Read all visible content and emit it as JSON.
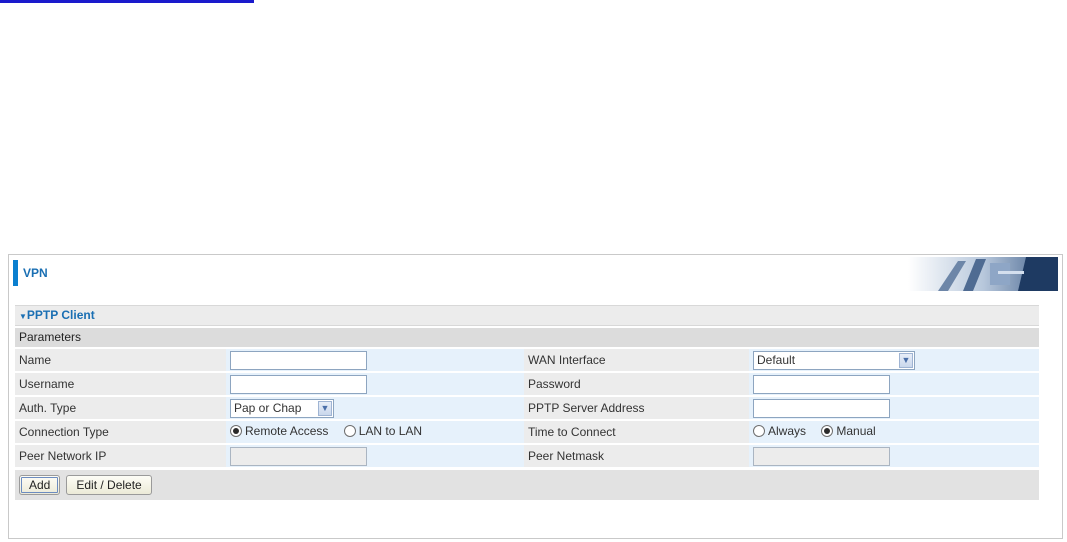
{
  "header": {
    "title": "VPN"
  },
  "section": {
    "title": "PPTP Client",
    "subheader": "Parameters"
  },
  "fields": {
    "name": {
      "label": "Name",
      "value": ""
    },
    "username": {
      "label": "Username",
      "value": ""
    },
    "auth_type": {
      "label": "Auth. Type",
      "selected": "Pap or Chap"
    },
    "connection_type": {
      "label": "Connection Type",
      "options": [
        "Remote Access",
        "LAN to LAN"
      ],
      "selected": "Remote Access"
    },
    "peer_network_ip": {
      "label": "Peer Network IP",
      "value": ""
    },
    "wan_interface": {
      "label": "WAN Interface",
      "selected": "Default"
    },
    "password": {
      "label": "Password",
      "value": ""
    },
    "pptp_server_address": {
      "label": "PPTP Server Address",
      "value": ""
    },
    "time_to_connect": {
      "label": "Time to Connect",
      "options": [
        "Always",
        "Manual"
      ],
      "selected": "Manual"
    },
    "peer_netmask": {
      "label": "Peer Netmask",
      "value": ""
    }
  },
  "buttons": {
    "add": "Add",
    "edit_delete": "Edit / Delete"
  },
  "colors": {
    "accent": "#0a7fcf",
    "title": "#1a6fb3",
    "top_line": "#1a1acc"
  },
  "icons": {
    "collapse": "triangle-down-icon",
    "dropdown": "chevron-down-icon",
    "banner": "network-banner-image"
  }
}
